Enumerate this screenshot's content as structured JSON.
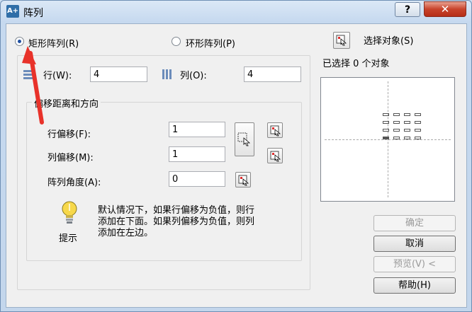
{
  "window": {
    "title": "阵列",
    "app_icon_text": "A+"
  },
  "titlebar": {
    "help_label": "?",
    "close_label": "✕"
  },
  "array_type": {
    "rect_label": "矩形阵列(R)",
    "polar_label": "环形阵列(P)",
    "selected": "rect"
  },
  "select_objects": {
    "label": "选择对象(S)",
    "status": "已选择 0 个对象"
  },
  "rows": {
    "label": "行(W):",
    "value": "4"
  },
  "columns": {
    "label": "列(O):",
    "value": "4"
  },
  "offset_group": {
    "title": "偏移距离和方向",
    "row_offset_label": "行偏移(F):",
    "row_offset_value": "1",
    "col_offset_label": "列偏移(M):",
    "col_offset_value": "1",
    "angle_label": "阵列角度(A):",
    "angle_value": "0"
  },
  "tip": {
    "title": "提示",
    "text_line1": "默认情况下，如果行偏移为负值，则行",
    "text_line2": "添加在下面。如果列偏移为负值，则列",
    "text_line3": "添加在左边。"
  },
  "buttons": {
    "ok": "确定",
    "cancel": "取消",
    "preview": "预览(V) <",
    "help": "帮助(H)"
  },
  "colors": {
    "annotation_arrow": "#e8322a",
    "accent": "#1f4fa0"
  }
}
